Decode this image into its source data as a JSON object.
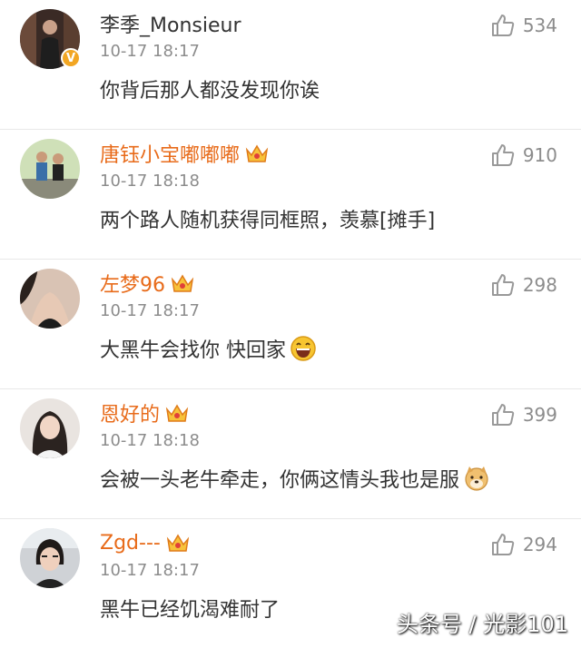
{
  "comments": [
    {
      "name": "李季_Monsieur",
      "vip": false,
      "verified": true,
      "time": "10-17 18:17",
      "text": "你背后那人都没发现你诶",
      "emoji": "",
      "likes": "534"
    },
    {
      "name": "唐钰小宝嘟嘟嘟",
      "vip": true,
      "verified": false,
      "time": "10-17 18:18",
      "text": "两个路人随机获得同框照，羡慕[摊手]",
      "emoji": "",
      "likes": "910"
    },
    {
      "name": "左梦96",
      "vip": true,
      "verified": false,
      "time": "10-17 18:17",
      "text": "大黑牛会找你 快回家",
      "emoji": "laughing-emoji",
      "likes": "298"
    },
    {
      "name": "恩好的",
      "vip": true,
      "verified": false,
      "time": "10-17 18:18",
      "text": "会被一头老牛牵走，你俩这情头我也是服",
      "emoji": "doge-emoji",
      "likes": "399"
    },
    {
      "name": "Zgd---",
      "vip": true,
      "verified": false,
      "time": "10-17 18:17",
      "text": "黑牛已经饥渴难耐了",
      "emoji": "",
      "likes": "294"
    }
  ],
  "watermark": "头条号 / 光影101",
  "colors": {
    "vip_name": "#e86b1a",
    "normal_name": "#333333",
    "meta": "#8c8c8c",
    "verified_badge": "#f2a623"
  }
}
